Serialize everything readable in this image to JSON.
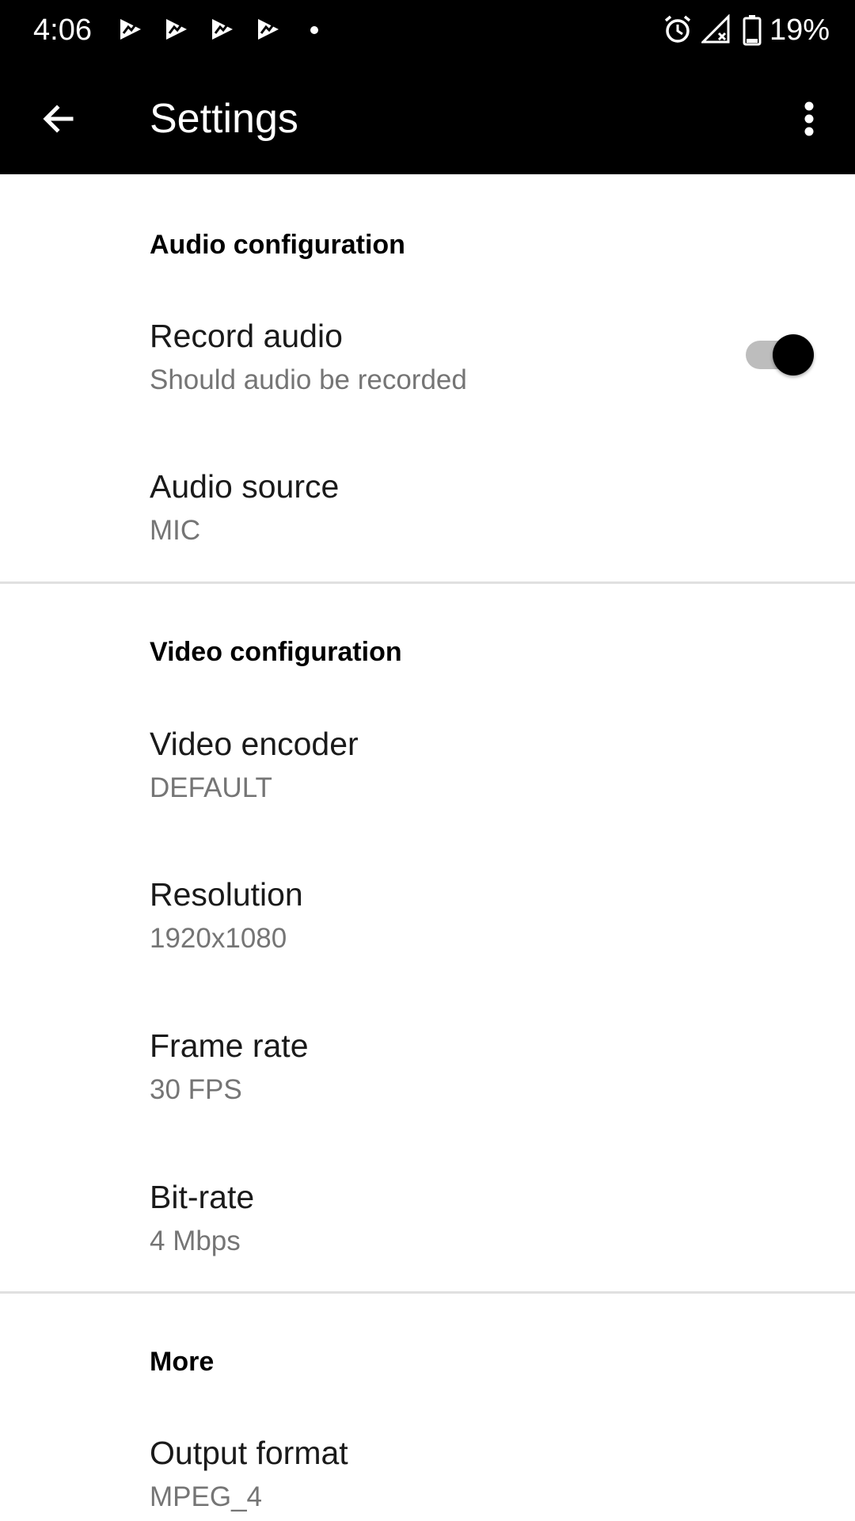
{
  "status_bar": {
    "time": "4:06",
    "battery_percent": "19%",
    "notification_icons": [
      "notification-icon",
      "notification-icon",
      "notification-icon",
      "notification-icon"
    ],
    "system_icons": [
      "alarm-icon",
      "signal-icon",
      "battery-icon"
    ]
  },
  "app_bar": {
    "title": "Settings",
    "back_icon": "arrow-back-icon",
    "more_icon": "more-vert-icon",
    "background": "#000000"
  },
  "sections": {
    "audio": {
      "header": "Audio configuration",
      "record_audio": {
        "title": "Record audio",
        "summary": "Should audio be recorded",
        "enabled": true
      },
      "audio_source": {
        "title": "Audio source",
        "summary": "MIC"
      }
    },
    "video": {
      "header": "Video configuration",
      "video_encoder": {
        "title": "Video encoder",
        "summary": "DEFAULT"
      },
      "resolution": {
        "title": "Resolution",
        "summary": "1920x1080"
      },
      "frame_rate": {
        "title": "Frame rate",
        "summary": "30 FPS"
      },
      "bit_rate": {
        "title": "Bit-rate",
        "summary": "4 Mbps"
      }
    },
    "more": {
      "header": "More",
      "output_format": {
        "title": "Output format",
        "summary": "MPEG_4"
      }
    }
  },
  "colors": {
    "switch_thumb": "#000000",
    "switch_track": "#bdbdbd",
    "summary_text": "#757575"
  }
}
